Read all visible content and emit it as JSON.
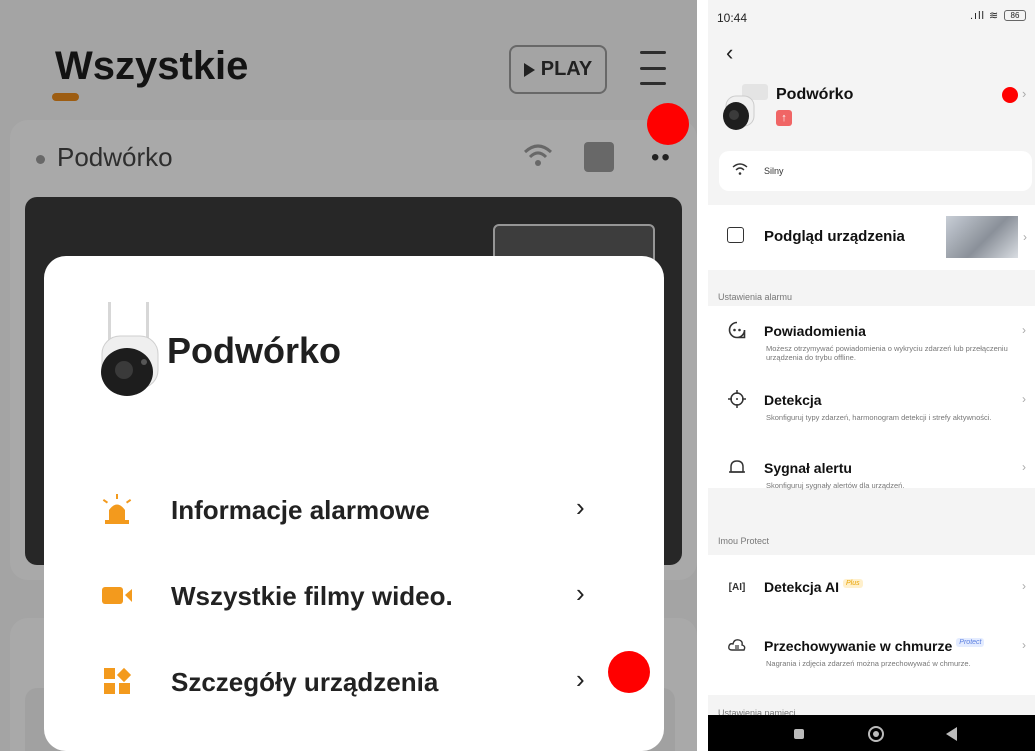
{
  "left": {
    "page_title": "Wszystkie",
    "play_label": "PLAY",
    "device_card_name": "Podwórko",
    "sheet": {
      "device_name": "Podwórko",
      "options": [
        {
          "label": "Informacje alarmowe",
          "icon": "alarm-light-icon"
        },
        {
          "label": "Wszystkie filmy wideo.",
          "icon": "video-camera-icon"
        },
        {
          "label": "Szczegóły urządzenia",
          "icon": "device-details-icon"
        }
      ]
    },
    "accent_color": "#e8891b"
  },
  "phone": {
    "status": {
      "time": "10:44",
      "battery": "86"
    },
    "device": {
      "name": "Podwórko"
    },
    "wifi_strength": "Silny",
    "preview_label": "Podgląd urządzenia",
    "alarm_section_title": "Ustawienia alarmu",
    "alarm_rows": [
      {
        "title": "Powiadomienia",
        "desc": "Możesz otrzymywać powiadomienia o wykryciu zdarzeń lub przełączeniu urządzenia do trybu offline.",
        "icon": "notification-icon"
      },
      {
        "title": "Detekcja",
        "desc": "Skonfiguruj typy zdarzeń, harmonogram detekcji i strefy aktywności.",
        "icon": "crosshair-icon"
      },
      {
        "title": "Sygnał alertu",
        "desc": "Skonfiguruj sygnały alertów dla urządzeń.",
        "icon": "bell-icon"
      }
    ],
    "protect_section_title": "Imou Protect",
    "ai_row": {
      "title": "Detekcja AI",
      "badge": "Plus"
    },
    "cloud_row": {
      "title": "Przechowywanie w chmurze",
      "badge": "Protect",
      "desc": "Nagrania i zdjęcia zdarzeń można przechowywać w chmurze."
    },
    "memory_section_title": "Ustawienia pamięci"
  },
  "markers_color": "#ff0000"
}
